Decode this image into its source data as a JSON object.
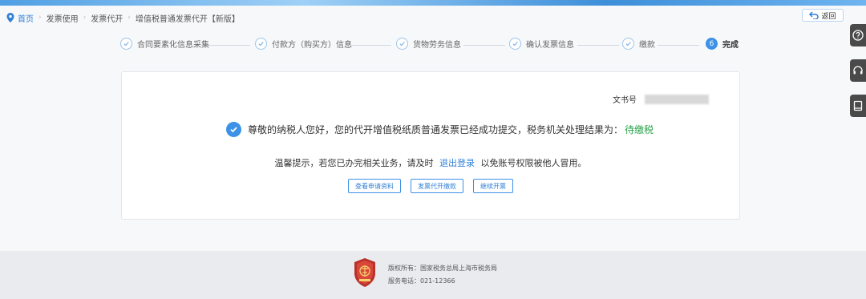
{
  "breadcrumb": {
    "home": "首页",
    "items": [
      "发票使用",
      "发票代开",
      "增值税普通发票代开【新版】"
    ]
  },
  "back_button": "返回",
  "steps": [
    {
      "label": "合同要素化信息采集",
      "state": "done"
    },
    {
      "label": "付款方（购买方）信息",
      "state": "done"
    },
    {
      "label": "货物劳务信息",
      "state": "done"
    },
    {
      "label": "确认发票信息",
      "state": "done"
    },
    {
      "label": "缴款",
      "state": "done"
    },
    {
      "number": "6",
      "label": "完成",
      "state": "active"
    }
  ],
  "result": {
    "doc_no_label": "文书号",
    "message": "尊敬的纳税人您好，您的代开增值税纸质普通发票已经成功提交，税务机关处理结果为：",
    "status": "待缴税",
    "tip_prefix": "温馨提示，若您已办完相关业务，请及时",
    "tip_link": "退出登录",
    "tip_suffix": "以免账号权限被他人冒用。"
  },
  "actions": [
    "查看申请资料",
    "发票代开缴款",
    "继续开票"
  ],
  "footer": {
    "copyright": "版权所有：国家税务总局上海市税务局",
    "phone": "服务电话：021-12366"
  },
  "colors": {
    "accent": "#3d91e6",
    "status": "#2aa24a",
    "link": "#2f7fd6"
  },
  "icons": [
    "location-pin-icon",
    "back-arrow-icon",
    "help-icon",
    "headset-icon",
    "book-icon",
    "check-icon",
    "tax-emblem"
  ]
}
